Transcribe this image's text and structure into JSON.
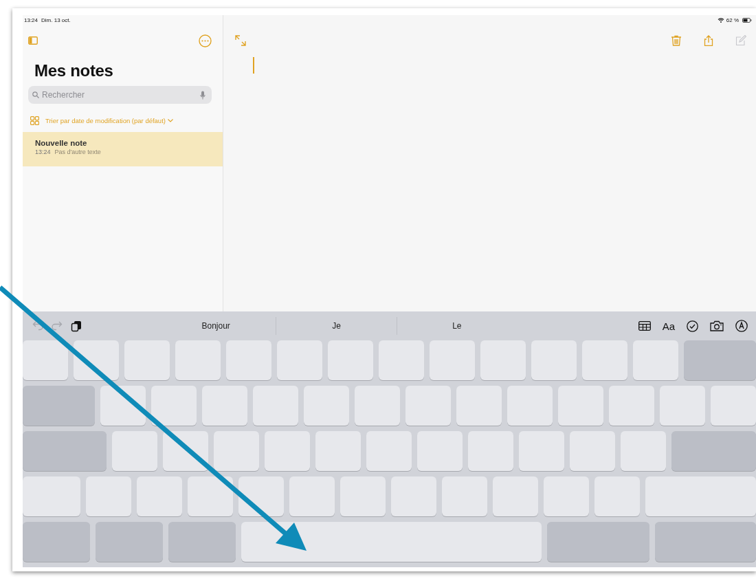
{
  "status_bar": {
    "time": "13:24",
    "date": "Dim. 13 oct.",
    "battery": "62 %"
  },
  "sidebar": {
    "title": "Mes notes",
    "search": {
      "placeholder": "Rechercher"
    },
    "sort_label": "Trier par date de modification (par défaut)",
    "notes": [
      {
        "title": "Nouvelle note",
        "time": "13:24",
        "preview": "Pas d'autre texte",
        "selected": true
      }
    ]
  },
  "editor": {
    "toolbar": [
      {
        "kind": "trash",
        "disabled": false
      },
      {
        "kind": "share",
        "disabled": false
      },
      {
        "kind": "compose",
        "disabled": true
      }
    ]
  },
  "keyboard": {
    "left_tools": [
      {
        "kind": "undo",
        "disabled": true
      },
      {
        "kind": "redo",
        "disabled": true
      },
      {
        "kind": "paste",
        "disabled": false
      }
    ],
    "suggestions": [
      "Bonjour",
      "Je",
      "Le"
    ],
    "format_label": "Aa",
    "rows": [
      {
        "keys": [
          {
            "kind": "letter"
          },
          {
            "kind": "letter"
          },
          {
            "kind": "letter"
          },
          {
            "kind": "letter"
          },
          {
            "kind": "letter"
          },
          {
            "kind": "letter"
          },
          {
            "kind": "letter"
          },
          {
            "kind": "letter"
          },
          {
            "kind": "letter"
          },
          {
            "kind": "letter"
          },
          {
            "kind": "letter"
          },
          {
            "kind": "letter"
          },
          {
            "kind": "letter"
          },
          {
            "kind": "delete"
          }
        ]
      },
      {
        "keys": [
          {
            "kind": "tab"
          },
          {
            "kind": "letter"
          },
          {
            "kind": "letter"
          },
          {
            "kind": "letter"
          },
          {
            "kind": "letter"
          },
          {
            "kind": "letter"
          },
          {
            "kind": "letter"
          },
          {
            "kind": "letter"
          },
          {
            "kind": "letter"
          },
          {
            "kind": "letter"
          },
          {
            "kind": "letter"
          },
          {
            "kind": "letter"
          },
          {
            "kind": "letter"
          },
          {
            "kind": "letter"
          }
        ]
      },
      {
        "keys": [
          {
            "kind": "caps"
          },
          {
            "kind": "letter"
          },
          {
            "kind": "letter"
          },
          {
            "kind": "letter"
          },
          {
            "kind": "letter"
          },
          {
            "kind": "letter"
          },
          {
            "kind": "letter"
          },
          {
            "kind": "letter"
          },
          {
            "kind": "letter"
          },
          {
            "kind": "letter"
          },
          {
            "kind": "letter"
          },
          {
            "kind": "letter"
          },
          {
            "kind": "return"
          }
        ]
      },
      {
        "keys": [
          {
            "kind": "shift"
          },
          {
            "kind": "letter"
          },
          {
            "kind": "letter"
          },
          {
            "kind": "letter"
          },
          {
            "kind": "letter"
          },
          {
            "kind": "letter"
          },
          {
            "kind": "letter"
          },
          {
            "kind": "letter"
          },
          {
            "kind": "letter"
          },
          {
            "kind": "letter"
          },
          {
            "kind": "letter"
          },
          {
            "kind": "letter"
          },
          {
            "kind": "shift"
          }
        ]
      },
      {
        "keys": [
          {
            "kind": "modifier"
          },
          {
            "kind": "modifier"
          },
          {
            "kind": "modifier"
          },
          {
            "kind": "space"
          },
          {
            "kind": "alt"
          },
          {
            "kind": "modifier"
          }
        ]
      }
    ]
  }
}
